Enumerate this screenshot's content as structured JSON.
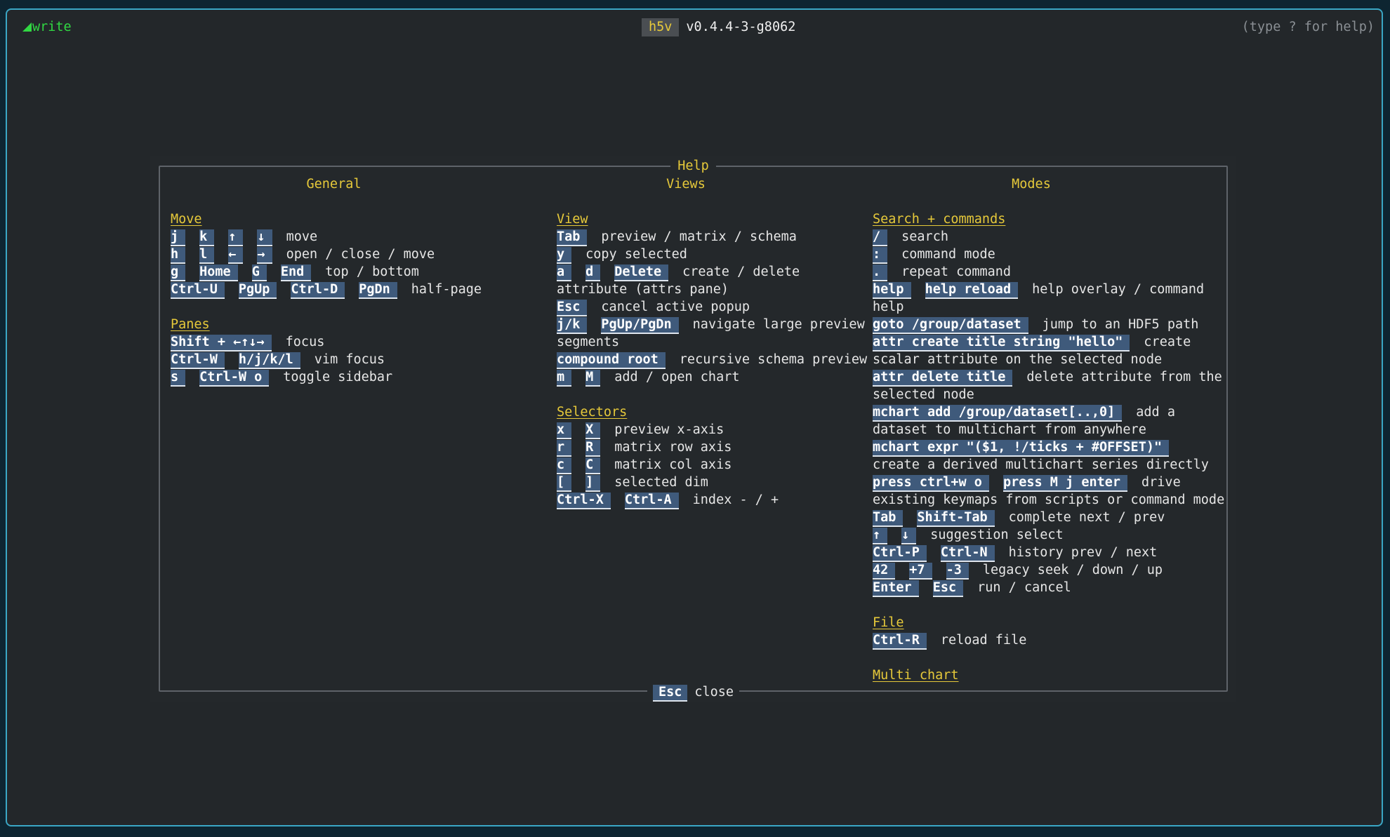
{
  "topbar": {
    "mode_label": "write",
    "app_name": "h5v",
    "app_version": "v0.4.4-3-g8062",
    "hint": "(type ? for help)"
  },
  "help": {
    "title": "Help",
    "close_key": "Esc",
    "close_label": "close",
    "columns": [
      {
        "header": "General"
      },
      {
        "header": "Views"
      },
      {
        "header": "Modes"
      }
    ]
  },
  "general": {
    "move_title": "Move",
    "move": [
      {
        "keys": [
          "j",
          "k",
          "↑",
          "↓"
        ],
        "desc": "move"
      },
      {
        "keys": [
          "h",
          "l",
          "←",
          "→"
        ],
        "desc": "open / close / move"
      },
      {
        "keys": [
          "g",
          "Home",
          "G",
          "End"
        ],
        "desc": "top / bottom"
      },
      {
        "keys": [
          "Ctrl-U",
          "PgUp",
          "Ctrl-D",
          "PgDn"
        ],
        "desc": "half-page"
      }
    ],
    "panes_title": "Panes",
    "panes": [
      {
        "keys": [
          "Shift + ←↑↓→"
        ],
        "desc": "focus"
      },
      {
        "keys": [
          "Ctrl-W",
          "h/j/k/l"
        ],
        "desc": "vim focus"
      },
      {
        "keys": [
          "s",
          "Ctrl-W o"
        ],
        "desc": "toggle sidebar"
      }
    ]
  },
  "views": {
    "view_title": "View",
    "view": [
      {
        "keys": [
          "Tab"
        ],
        "desc": "preview / matrix / schema"
      },
      {
        "keys": [
          "y"
        ],
        "desc": "copy selected"
      },
      {
        "keys": [
          "a",
          "d",
          "Delete"
        ],
        "desc": "create / delete"
      },
      {
        "keys": [],
        "desc": "attribute (attrs pane)"
      },
      {
        "keys": [
          "Esc"
        ],
        "desc": "cancel active popup"
      },
      {
        "keys": [
          "j/k",
          "PgUp/PgDn"
        ],
        "desc": "navigate large preview"
      },
      {
        "keys": [],
        "desc": "segments"
      },
      {
        "keys": [
          "compound root"
        ],
        "desc": "recursive schema preview"
      },
      {
        "keys": [
          "m",
          "M"
        ],
        "desc": "add / open chart"
      }
    ],
    "selectors_title": "Selectors",
    "selectors": [
      {
        "keys": [
          "x",
          "X"
        ],
        "desc": "preview x-axis"
      },
      {
        "keys": [
          "r",
          "R"
        ],
        "desc": "matrix row axis"
      },
      {
        "keys": [
          "c",
          "C"
        ],
        "desc": "matrix col axis"
      },
      {
        "keys": [
          "[",
          "]"
        ],
        "desc": "selected dim"
      },
      {
        "keys": [
          "Ctrl-X",
          "Ctrl-A"
        ],
        "desc": "index - / +"
      }
    ]
  },
  "modes": {
    "search_title": "Search + commands",
    "search": [
      {
        "keys": [
          "/"
        ],
        "desc": "search"
      },
      {
        "keys": [
          ":"
        ],
        "desc": "command mode"
      },
      {
        "keys": [
          "."
        ],
        "desc": "repeat command"
      },
      {
        "keys": [
          "help",
          "help reload"
        ],
        "desc": "help overlay / command"
      },
      {
        "keys": [],
        "desc": "help"
      },
      {
        "keys": [
          "goto /group/dataset"
        ],
        "desc": "jump to an HDF5 path"
      },
      {
        "keys": [
          "attr create title string \"hello\""
        ],
        "desc": "create"
      },
      {
        "keys": [],
        "desc": "scalar attribute on the selected node"
      },
      {
        "keys": [
          "attr delete title"
        ],
        "desc": "delete attribute from the"
      },
      {
        "keys": [],
        "desc": "selected node"
      },
      {
        "keys": [
          "mchart add /group/dataset[..,0]"
        ],
        "desc": "add a"
      },
      {
        "keys": [],
        "desc": "dataset to multichart from anywhere"
      },
      {
        "keys": [
          "mchart expr \"($1, !/ticks + #OFFSET)\""
        ],
        "desc": ""
      },
      {
        "keys": [],
        "desc": "create a derived multichart series directly"
      },
      {
        "keys": [
          "press ctrl+w o",
          "press M j enter"
        ],
        "desc": "drive"
      },
      {
        "keys": [],
        "desc": "existing keymaps from scripts or command mode"
      },
      {
        "keys": [
          "Tab",
          "Shift-Tab"
        ],
        "desc": "complete next / prev"
      },
      {
        "keys": [
          "↑",
          "↓"
        ],
        "desc": "suggestion select"
      },
      {
        "keys": [
          "Ctrl-P",
          "Ctrl-N"
        ],
        "desc": "history prev / next"
      },
      {
        "keys": [
          "42",
          "+7",
          "-3"
        ],
        "desc": "legacy seek / down / up"
      },
      {
        "keys": [
          "Enter",
          "Esc"
        ],
        "desc": "run / cancel"
      }
    ],
    "file_title": "File",
    "file": [
      {
        "keys": [
          "Ctrl-R"
        ],
        "desc": "reload file"
      }
    ],
    "multichart_title": "Multi chart"
  }
}
